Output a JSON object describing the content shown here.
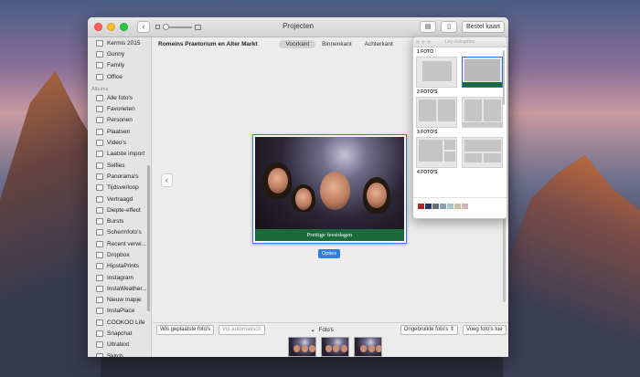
{
  "window": {
    "title": "Projecten",
    "order_button": "Bestel kaart"
  },
  "sidebar": {
    "items_top": [
      {
        "label": "Kermis 2015",
        "icon": "folder-icon"
      },
      {
        "label": "Gonny",
        "icon": "folder-icon"
      },
      {
        "label": "Family",
        "icon": "folder-icon"
      },
      {
        "label": "Office",
        "icon": "folder-icon"
      }
    ],
    "albums_header": "Albums",
    "albums": [
      {
        "label": "Alle foto's",
        "icon": "photos-icon"
      },
      {
        "label": "Favorieten",
        "icon": "heart-icon"
      },
      {
        "label": "Personen",
        "icon": "person-icon"
      },
      {
        "label": "Plaatsen",
        "icon": "pin-icon"
      },
      {
        "label": "Video's",
        "icon": "video-icon"
      },
      {
        "label": "Laatste import",
        "icon": "clock-icon"
      },
      {
        "label": "Selfies",
        "icon": "selfie-icon"
      },
      {
        "label": "Panorama's",
        "icon": "panorama-icon"
      },
      {
        "label": "Tijdsverloop",
        "icon": "timelapse-icon"
      },
      {
        "label": "Vertraagd",
        "icon": "slowmo-icon"
      },
      {
        "label": "Diepte-effect",
        "icon": "depth-icon"
      },
      {
        "label": "Bursts",
        "icon": "burst-icon"
      },
      {
        "label": "Schermfoto's",
        "icon": "screenshot-icon"
      },
      {
        "label": "Recent verwi...",
        "icon": "trash-icon"
      },
      {
        "label": "Dropbox",
        "icon": "folder-icon"
      },
      {
        "label": "HipstaPrints",
        "icon": "folder-icon"
      },
      {
        "label": "Instagram",
        "icon": "folder-icon"
      },
      {
        "label": "InstaWeather...",
        "icon": "folder-icon"
      },
      {
        "label": "Nieuw mapje",
        "icon": "folder-icon"
      },
      {
        "label": "InstaPlace",
        "icon": "folder-icon"
      },
      {
        "label": "COOKOO Life",
        "icon": "folder-icon"
      },
      {
        "label": "Snapchat",
        "icon": "folder-icon"
      },
      {
        "label": "Ultratext",
        "icon": "folder-icon"
      },
      {
        "label": "Skitch",
        "icon": "folder-icon"
      }
    ]
  },
  "main": {
    "project_name": "Romeins Praetorium en Alter Markt",
    "tabs": [
      {
        "label": "Voorkant",
        "active": true
      },
      {
        "label": "Binnenkant",
        "active": false
      },
      {
        "label": "Achterkant",
        "active": false
      }
    ],
    "card_caption": "Prettige feestdagen",
    "options_button": "Opties"
  },
  "bottom_bar": {
    "clear_button": "Wis geplaatste foto's",
    "autofill_button": "Vul automatisch",
    "photos_toggle": "Foto's",
    "filter_select": "Ongebruikte foto's",
    "add_button": "Voeg foto's toe"
  },
  "layout_panel": {
    "title": "Lay-outopties",
    "sections": [
      {
        "label": "1 FOTO"
      },
      {
        "label": "2 FOTO'S"
      },
      {
        "label": "3 FOTO'S"
      },
      {
        "label": "4 FOTO'S"
      }
    ],
    "swatch_colors": [
      "#b3262d",
      "#24386b",
      "#6b6e73",
      "#8a9fb3",
      "#a9c6c4",
      "#c9c2a5",
      "#d4b3b8"
    ]
  },
  "colors": {
    "accent": "#2d7fe0",
    "card_band": "#1b6a3c"
  }
}
